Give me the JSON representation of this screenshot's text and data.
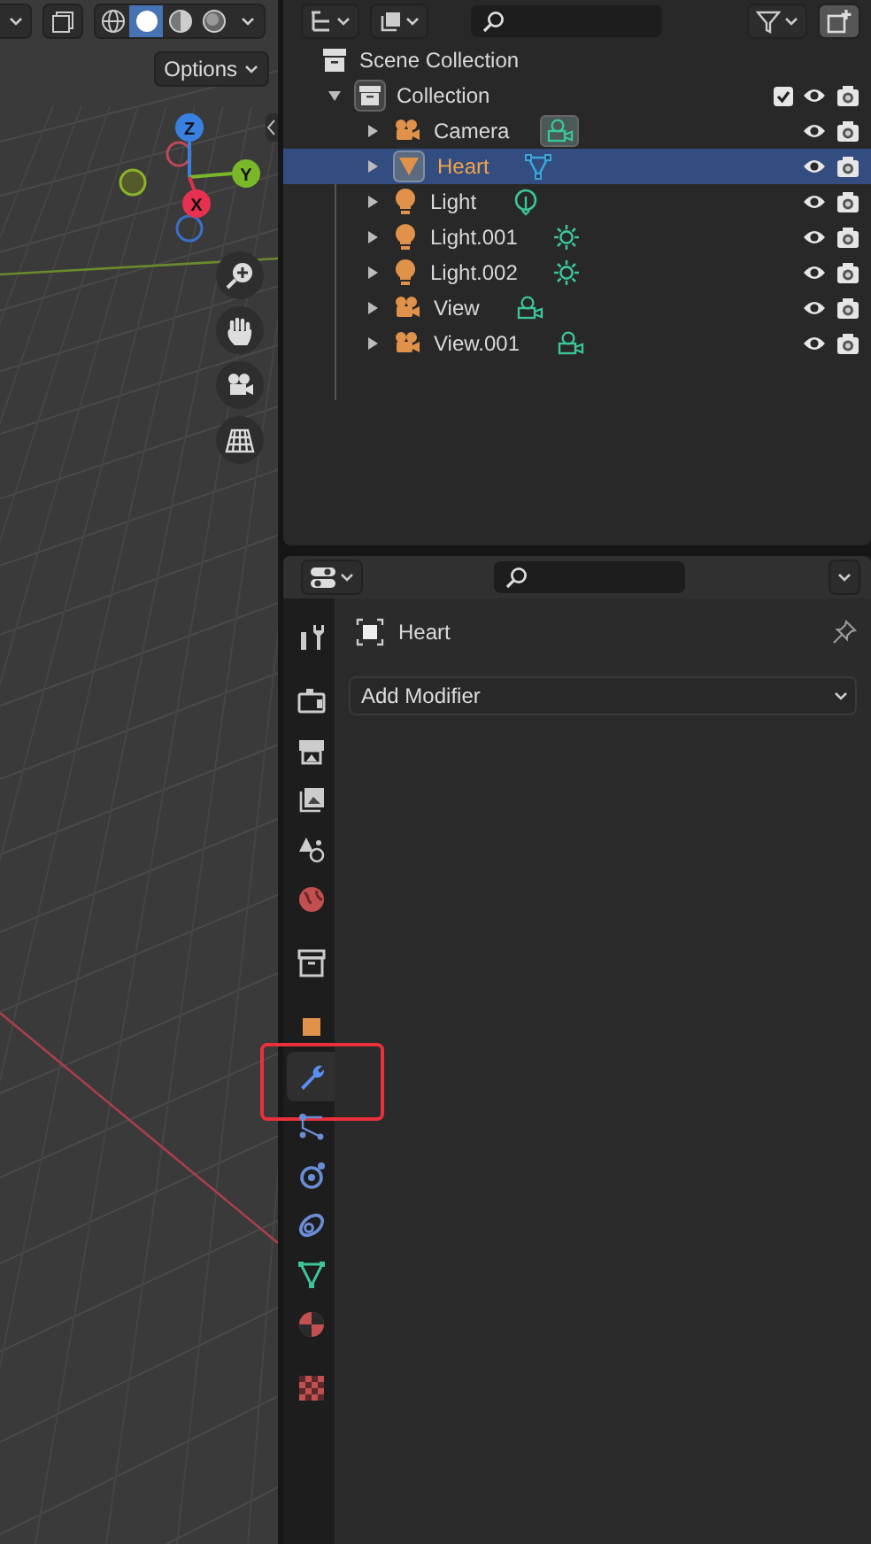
{
  "viewport": {
    "shading_modes": [
      {
        "kind": "wireframe",
        "selected": false
      },
      {
        "kind": "solid",
        "selected": true
      },
      {
        "kind": "material",
        "selected": false
      },
      {
        "kind": "rendered",
        "selected": false
      }
    ],
    "options_label": "Options",
    "gizmo_axes": [
      {
        "label": "Z"
      },
      {
        "label": "Y"
      },
      {
        "label": "X"
      }
    ]
  },
  "outliner": {
    "scene_collection": "Scene Collection",
    "collection": {
      "name": "Collection",
      "expanded": true,
      "checked": true
    },
    "rows": [
      {
        "name": "Camera",
        "kind": "camera",
        "data": {
          "kind": "camera",
          "active": true
        },
        "selected": false
      },
      {
        "name": "Heart",
        "kind": "mesh",
        "data": {
          "kind": "mesh",
          "active": false
        },
        "selected": true
      },
      {
        "name": "Light",
        "kind": "light",
        "data": {
          "kind": "point",
          "active": false
        },
        "selected": false
      },
      {
        "name": "Light.001",
        "kind": "light",
        "data": {
          "kind": "sun",
          "active": false
        },
        "selected": false
      },
      {
        "name": "Light.002",
        "kind": "light",
        "data": {
          "kind": "sun",
          "active": false
        },
        "selected": false
      },
      {
        "name": "View",
        "kind": "camera",
        "data": {
          "kind": "camera",
          "active": false
        },
        "selected": false
      },
      {
        "name": "View.001",
        "kind": "camera",
        "data": {
          "kind": "camera",
          "active": false
        },
        "selected": false
      }
    ]
  },
  "properties": {
    "object_name": "Heart",
    "add_modifier": "Add Modifier",
    "tab_groups": [
      [
        {
          "kind": "tool",
          "selected": false,
          "highlighted": false
        }
      ],
      [
        {
          "kind": "render",
          "selected": false,
          "highlighted": false
        },
        {
          "kind": "output",
          "selected": false,
          "highlighted": false
        },
        {
          "kind": "view_layer",
          "selected": false,
          "highlighted": false
        },
        {
          "kind": "scene",
          "selected": false,
          "highlighted": false
        },
        {
          "kind": "world",
          "selected": false,
          "highlighted": false
        }
      ],
      [
        {
          "kind": "collection",
          "selected": false,
          "highlighted": false
        }
      ],
      [
        {
          "kind": "object",
          "selected": false,
          "highlighted": false
        },
        {
          "kind": "modifiers",
          "selected": true,
          "highlighted": true
        },
        {
          "kind": "particles",
          "selected": false,
          "highlighted": false
        },
        {
          "kind": "physics",
          "selected": false,
          "highlighted": false
        },
        {
          "kind": "constraints",
          "selected": false,
          "highlighted": false
        },
        {
          "kind": "data",
          "selected": false,
          "highlighted": false
        },
        {
          "kind": "material",
          "selected": false,
          "highlighted": false
        }
      ],
      [
        {
          "kind": "texture",
          "selected": false,
          "highlighted": false
        }
      ]
    ]
  }
}
